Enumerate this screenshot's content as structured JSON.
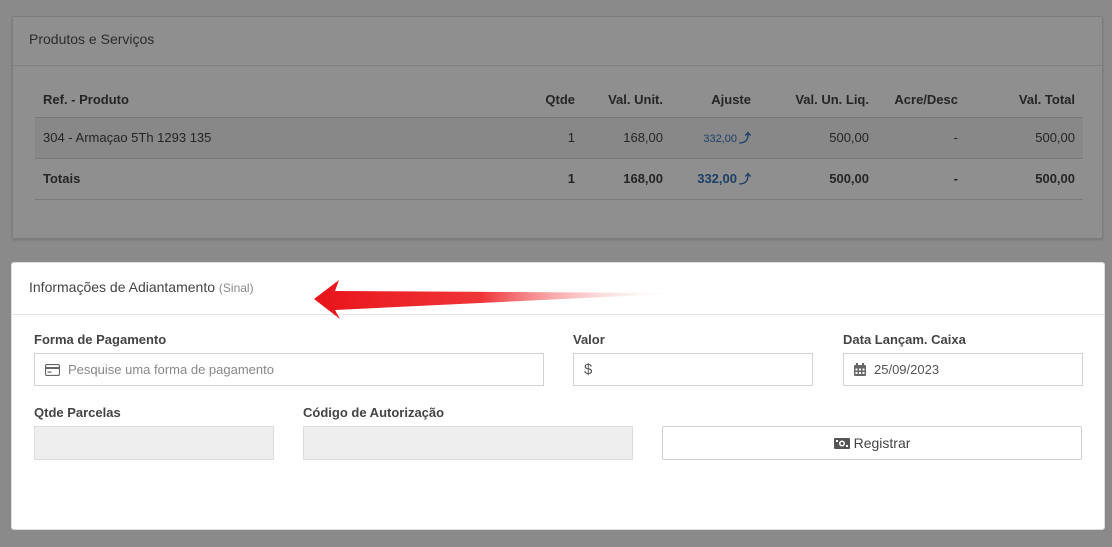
{
  "products_panel": {
    "title": "Produtos e Serviços",
    "columns": [
      "Ref. - Produto",
      "Qtde",
      "Val. Unit.",
      "Ajuste",
      "Val. Un. Liq.",
      "Acre/Desc",
      "Val. Total"
    ],
    "rows": [
      {
        "ref": "304 - Armaçao 5Th 1293 135",
        "qtde": "1",
        "val_unit": "168,00",
        "ajuste": "332,00",
        "val_un_liq": "500,00",
        "acre_desc": "-",
        "val_total": "500,00"
      }
    ],
    "totals": {
      "label": "Totais",
      "qtde": "1",
      "val_unit": "168,00",
      "ajuste": "332,00",
      "val_un_liq": "500,00",
      "acre_desc": "-",
      "val_total": "500,00"
    }
  },
  "advance_panel": {
    "title": "Informações de Adiantamento",
    "subtitle": "(Sinal)",
    "forma_pagamento_label": "Forma de Pagamento",
    "forma_pagamento_placeholder": "Pesquise uma forma de pagamento",
    "valor_label": "Valor",
    "valor_prefix": "$",
    "data_label": "Data Lançam. Caixa",
    "data_value": "25/09/2023",
    "parcelas_label": "Qtde Parcelas",
    "codigo_label": "Código de Autorização",
    "registrar_label": "Registrar"
  },
  "colors": {
    "annotation_arrow": "#e8141a",
    "link_blue": "#1d3f66"
  }
}
